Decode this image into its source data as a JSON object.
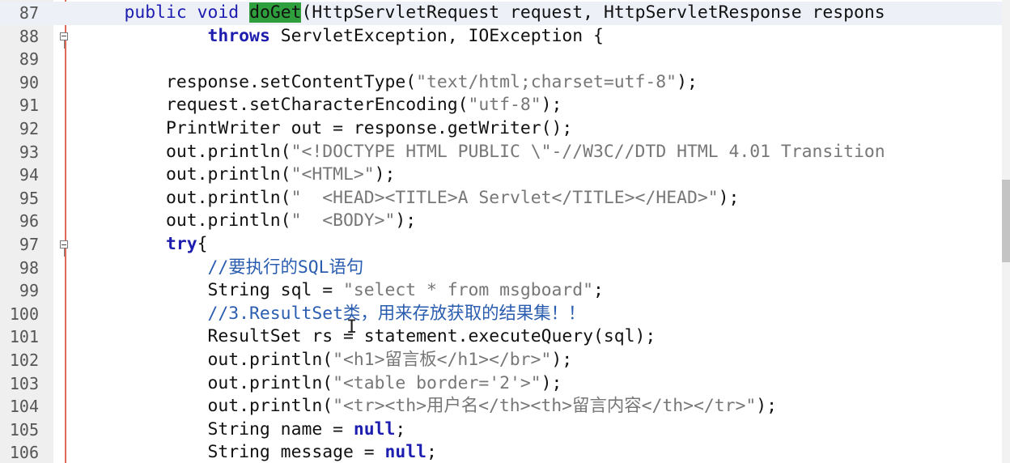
{
  "editor": {
    "language": "java",
    "highlighted_word": "doGet",
    "lines": [
      {
        "num": "87",
        "segments": [
          {
            "t": "    public void ",
            "c": "plainkw"
          },
          {
            "t": "doGet",
            "c": "hl"
          },
          {
            "t": "(HttpServletRequest request, HttpServletResponse respons",
            "c": ""
          }
        ]
      },
      {
        "num": "88",
        "segments": [
          {
            "t": "            ",
            "c": ""
          },
          {
            "t": "throws",
            "c": "kw"
          },
          {
            "t": " ServletException, IOException {",
            "c": ""
          }
        ]
      },
      {
        "num": "89",
        "segments": []
      },
      {
        "num": "90",
        "segments": [
          {
            "t": "        response.setContentType(",
            "c": ""
          },
          {
            "t": "\"text/html;charset=utf-8\"",
            "c": "str"
          },
          {
            "t": ");",
            "c": ""
          }
        ]
      },
      {
        "num": "91",
        "segments": [
          {
            "t": "        request.setCharacterEncoding(",
            "c": ""
          },
          {
            "t": "\"utf-8\"",
            "c": "str"
          },
          {
            "t": ");",
            "c": ""
          }
        ]
      },
      {
        "num": "92",
        "segments": [
          {
            "t": "        PrintWriter out = response.getWriter();",
            "c": ""
          }
        ]
      },
      {
        "num": "93",
        "segments": [
          {
            "t": "        out.println(",
            "c": ""
          },
          {
            "t": "\"<!DOCTYPE HTML PUBLIC \\\"-//W3C//DTD HTML 4.01 Transition",
            "c": "str"
          }
        ]
      },
      {
        "num": "94",
        "segments": [
          {
            "t": "        out.println(",
            "c": ""
          },
          {
            "t": "\"<HTML>\"",
            "c": "str"
          },
          {
            "t": ");",
            "c": ""
          }
        ]
      },
      {
        "num": "95",
        "segments": [
          {
            "t": "        out.println(",
            "c": ""
          },
          {
            "t": "\"  <HEAD><TITLE>A Servlet</TITLE></HEAD>\"",
            "c": "str"
          },
          {
            "t": ");",
            "c": ""
          }
        ]
      },
      {
        "num": "96",
        "segments": [
          {
            "t": "        out.println(",
            "c": ""
          },
          {
            "t": "\"  <BODY>\"",
            "c": "str"
          },
          {
            "t": ");",
            "c": ""
          }
        ]
      },
      {
        "num": "97",
        "segments": [
          {
            "t": "        ",
            "c": ""
          },
          {
            "t": "try",
            "c": "kw"
          },
          {
            "t": "{",
            "c": ""
          }
        ]
      },
      {
        "num": "98",
        "segments": [
          {
            "t": "            //要执行的SQL语句",
            "c": "cmt"
          }
        ]
      },
      {
        "num": "99",
        "segments": [
          {
            "t": "            String sql = ",
            "c": ""
          },
          {
            "t": "\"select * from msgboard\"",
            "c": "str"
          },
          {
            "t": ";",
            "c": ""
          }
        ]
      },
      {
        "num": "100",
        "segments": [
          {
            "t": "            //3.ResultSet类，用来存放获取的结果集！！",
            "c": "cmt"
          }
        ]
      },
      {
        "num": "101",
        "segments": [
          {
            "t": "            ResultSet rs = statement.executeQuery(sql);",
            "c": ""
          }
        ]
      },
      {
        "num": "102",
        "segments": [
          {
            "t": "            out.println(",
            "c": ""
          },
          {
            "t": "\"<h1>留言板</h1></br>\"",
            "c": "str"
          },
          {
            "t": ");",
            "c": ""
          }
        ]
      },
      {
        "num": "103",
        "segments": [
          {
            "t": "            out.println(",
            "c": ""
          },
          {
            "t": "\"<table border='2'>\"",
            "c": "str"
          },
          {
            "t": ");",
            "c": ""
          }
        ]
      },
      {
        "num": "104",
        "segments": [
          {
            "t": "            out.println(",
            "c": ""
          },
          {
            "t": "\"<tr><th>用户名</th><th>留言内容</th></tr>\"",
            "c": "str"
          },
          {
            "t": ");",
            "c": ""
          }
        ]
      },
      {
        "num": "105",
        "segments": [
          {
            "t": "            String name = ",
            "c": ""
          },
          {
            "t": "null",
            "c": "kw"
          },
          {
            "t": ";",
            "c": ""
          }
        ]
      },
      {
        "num": "106",
        "segments": [
          {
            "t": "            String message = ",
            "c": ""
          },
          {
            "t": "null",
            "c": "kw"
          },
          {
            "t": ";",
            "c": ""
          }
        ]
      }
    ],
    "fold_markers_at": [
      "88",
      "97"
    ],
    "current_line": "87",
    "colors": {
      "keyword": "#1d1db0",
      "string": "#777777",
      "comment": "#2a5db0",
      "highlight": "#2f9e3c",
      "margin_line": "#e06a5a"
    }
  }
}
